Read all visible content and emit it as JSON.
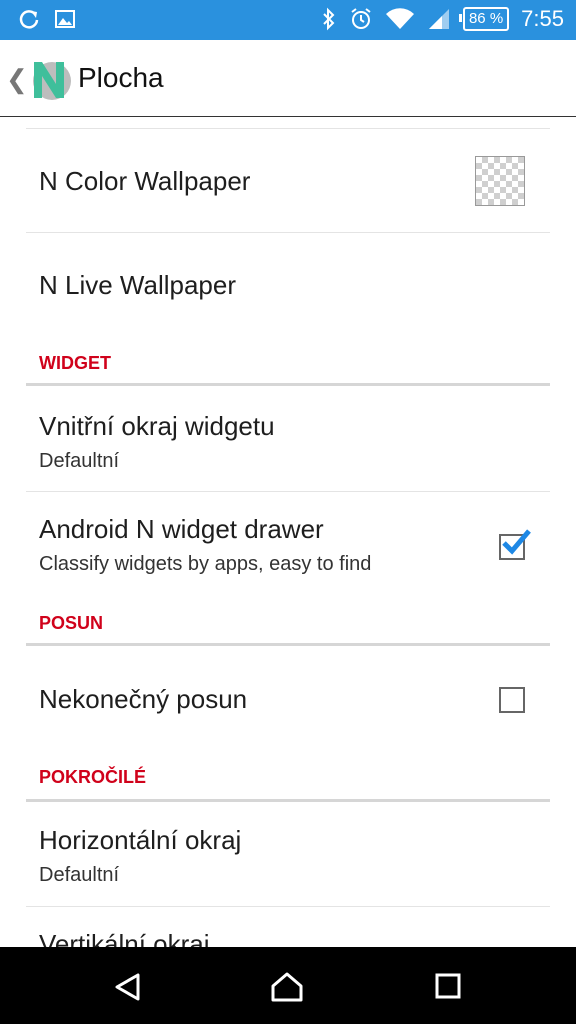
{
  "status": {
    "battery": "86 %",
    "time": "7:55"
  },
  "header": {
    "title": "Plocha",
    "logo_letter": "N"
  },
  "items": {
    "color_wallpaper": "N Color Wallpaper",
    "live_wallpaper": "N Live Wallpaper",
    "widget_padding_title": "Vnitřní okraj widgetu",
    "widget_padding_summary": "Defaultní",
    "widget_drawer_title": "Android N widget drawer",
    "widget_drawer_summary": "Classify widgets by apps, easy to find",
    "infinite_scroll_title": "Nekonečný posun",
    "horizontal_margin_title": "Horizontální okraj",
    "horizontal_margin_summary": "Defaultní",
    "vertical_margin_title": "Vertikální okraj"
  },
  "sections": {
    "widget": "WIDGET",
    "posun": "POSUN",
    "advanced": "POKROČILÉ"
  },
  "checks": {
    "widget_drawer": true,
    "infinite_scroll": false
  },
  "colors": {
    "status_bar": "#2a91de",
    "section_header": "#d0021b",
    "checkbox_accent": "#1e88e5"
  }
}
